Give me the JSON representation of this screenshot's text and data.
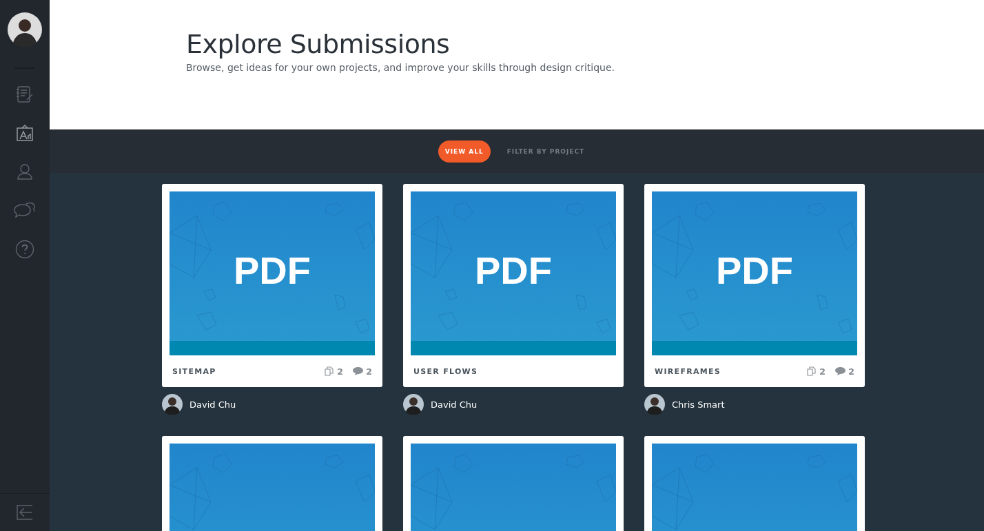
{
  "sidebar": {
    "nav": [
      {
        "kind": "notebook",
        "selected": false
      },
      {
        "kind": "easel",
        "selected": true
      },
      {
        "kind": "person",
        "selected": false
      },
      {
        "kind": "chat",
        "selected": false
      },
      {
        "kind": "help",
        "selected": false
      }
    ]
  },
  "header": {
    "title": "Explore Submissions",
    "subtitle": "Browse, get ideas for your own projects, and improve your skills through design critique."
  },
  "filters": [
    {
      "label": "VIEW ALL",
      "selected": true
    },
    {
      "label": "FILTER BY PROJECT",
      "selected": false
    }
  ],
  "submissions": [
    {
      "kind": "full",
      "thumbnail_label": "PDF",
      "project": "SITEMAP",
      "files": "2",
      "comments": "2",
      "author": "David Chu"
    },
    {
      "kind": "full",
      "thumbnail_label": "PDF",
      "project": "USER FLOWS",
      "author": "David Chu"
    },
    {
      "kind": "full",
      "thumbnail_label": "PDF",
      "project": "WIREFRAMES",
      "files": "2",
      "comments": "2",
      "author": "Chris Smart"
    },
    {
      "kind": "partial"
    },
    {
      "kind": "partial"
    },
    {
      "kind": "partial"
    }
  ]
}
